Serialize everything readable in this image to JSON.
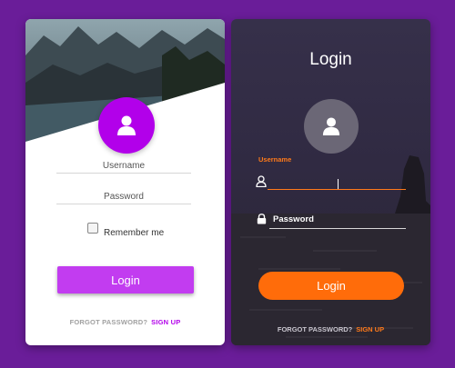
{
  "colors": {
    "background": "#6a1d99",
    "left_accent": "#b200ea",
    "left_button": "#c23cf0",
    "right_accent": "#ff6c0a"
  },
  "left_card": {
    "avatar_icon": "user-icon",
    "username_placeholder": "Username",
    "password_placeholder": "Password",
    "remember_label": "Remember me",
    "login_label": "Login",
    "forgot_label": "FORGOT PASSWORD?",
    "signup_label": "SIGN UP"
  },
  "right_card": {
    "title": "Login",
    "avatar_icon": "user-icon",
    "username_label": "Username",
    "password_placeholder": "Password",
    "login_label": "Login",
    "forgot_label": "FORGOT PASSWORD?",
    "signup_label": "SIGN UP"
  }
}
